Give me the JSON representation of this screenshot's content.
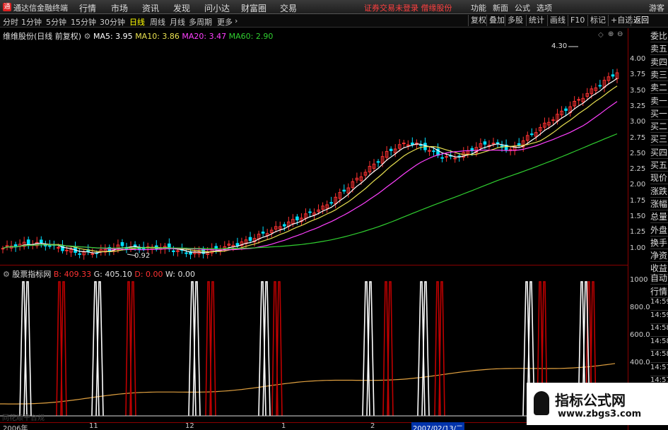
{
  "app": {
    "title": "通达信金融终端",
    "menus": [
      "行情",
      "市场",
      "资讯",
      "发现",
      "问小达",
      "财富圈",
      "交易"
    ],
    "notice": "证券交易未登录 僧缘股份",
    "right_menus": [
      "功能",
      "新面",
      "公式",
      "选项"
    ],
    "guest": "游客"
  },
  "periods": {
    "items": [
      "分时",
      "1分钟",
      "5分钟",
      "15分钟",
      "30分钟",
      "日线",
      "周线",
      "月线",
      "多周期",
      "更多"
    ],
    "active": "日线",
    "right_buttons": [
      "复权",
      "叠加",
      "多股",
      "统计",
      "画线",
      "F10",
      "标记",
      "+自选",
      "返回"
    ]
  },
  "stock": {
    "name": "维维股份(日线 前复权)",
    "ma5_label": "MA5: 3.95",
    "ma10_label": "MA10: 3.86",
    "ma20_label": "MA20: 3.47",
    "ma60_label": "MA60: 2.90",
    "high_label": "4.30",
    "low_label": "0.92"
  },
  "indicator": {
    "name": "股票指标网",
    "b_label": "B: 409.33",
    "g_label": "G: 405.10",
    "d_label": "D: 0.00",
    "w_label": "W: 0.00",
    "bottom_note": "同花顺平台规"
  },
  "axis": {
    "main_ticks": [
      "4.00",
      "3.75",
      "3.50",
      "3.25",
      "3.00",
      "2.75",
      "2.50",
      "2.25",
      "2.00",
      "1.75",
      "1.50",
      "1.25",
      "1.00"
    ],
    "ind_ticks": [
      "1000",
      "800.0",
      "600.0",
      "400.0"
    ],
    "dates": [
      "2006年",
      "11",
      "12",
      "1",
      "2"
    ],
    "current_date": "2007/02/13/二"
  },
  "side_tabs": [
    "委比",
    "卖五",
    "卖四",
    "卖三",
    "卖二",
    "卖一",
    "买一",
    "买二",
    "买三",
    "买四",
    "买五",
    "现价",
    "涨跌",
    "涨幅",
    "总量",
    "外盘",
    "换手",
    "净资",
    "收益",
    "自动",
    "行情",
    "14:59",
    "14:59",
    "14:58",
    "14:58",
    "14:58",
    "14:57",
    "14:57"
  ],
  "watermark": {
    "title": "指标公式网",
    "url": "www.zbgs3.com"
  },
  "colors": {
    "up": "#ff3232",
    "down": "#00e0ff",
    "ma5": "#ffffff",
    "ma10": "#e8e050",
    "ma20": "#ff40ff",
    "ma60": "#30d030",
    "white_spike": "#ffffff",
    "red_spike": "#c00000",
    "orange_line": "#e0a040"
  }
}
